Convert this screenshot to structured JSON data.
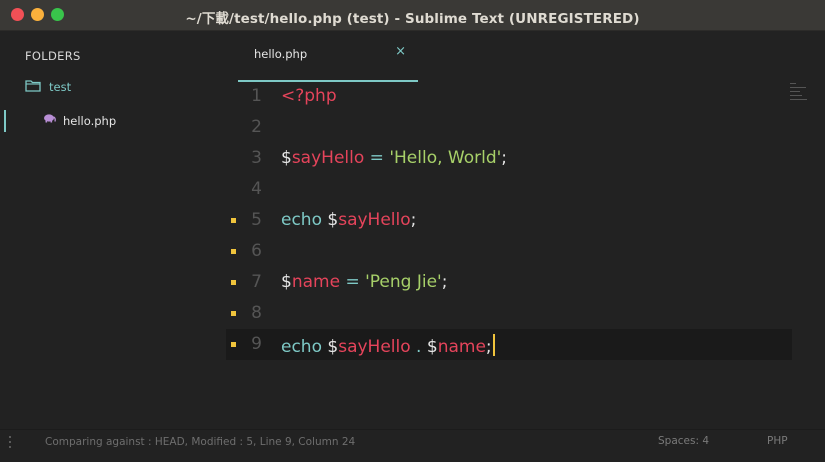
{
  "window": {
    "title": "~/下載/test/hello.php (test) - Sublime Text (UNREGISTERED)"
  },
  "sidebar": {
    "header": "FOLDERS",
    "folder": {
      "name": "test",
      "icon": "folder-icon"
    },
    "file": {
      "name": "hello.php",
      "icon": "php-elephant-icon"
    }
  },
  "tab": {
    "label": "hello.php",
    "close_glyph": "×"
  },
  "editor": {
    "current_line": 9,
    "lines": [
      {
        "num": "1",
        "modified": false,
        "tokens": [
          {
            "t": "<?php",
            "c": "tag"
          }
        ]
      },
      {
        "num": "2",
        "modified": false,
        "tokens": []
      },
      {
        "num": "3",
        "modified": false,
        "tokens": [
          {
            "t": "$",
            "c": "dollar"
          },
          {
            "t": "sayHello",
            "c": "var"
          },
          {
            "t": " = ",
            "c": "op"
          },
          {
            "t": "'Hello, World'",
            "c": "str"
          },
          {
            "t": ";",
            "c": "plain"
          }
        ]
      },
      {
        "num": "4",
        "modified": false,
        "tokens": []
      },
      {
        "num": "5",
        "modified": true,
        "tokens": [
          {
            "t": "echo ",
            "c": "kw"
          },
          {
            "t": "$",
            "c": "dollar"
          },
          {
            "t": "sayHello",
            "c": "var"
          },
          {
            "t": ";",
            "c": "plain"
          }
        ]
      },
      {
        "num": "6",
        "modified": true,
        "tokens": []
      },
      {
        "num": "7",
        "modified": true,
        "tokens": [
          {
            "t": "$",
            "c": "dollar"
          },
          {
            "t": "name",
            "c": "var"
          },
          {
            "t": " = ",
            "c": "op"
          },
          {
            "t": "'Peng Jie'",
            "c": "str"
          },
          {
            "t": ";",
            "c": "plain"
          }
        ]
      },
      {
        "num": "8",
        "modified": true,
        "tokens": []
      },
      {
        "num": "9",
        "modified": true,
        "tokens": [
          {
            "t": "echo ",
            "c": "kw"
          },
          {
            "t": "$",
            "c": "dollar"
          },
          {
            "t": "sayHello",
            "c": "var"
          },
          {
            "t": " . ",
            "c": "op"
          },
          {
            "t": "$",
            "c": "dollar"
          },
          {
            "t": "name",
            "c": "var"
          },
          {
            "t": ";",
            "c": "plain"
          }
        ]
      }
    ]
  },
  "status": {
    "info": "Comparing against : HEAD, Modified : 5, Line 9, Column 24",
    "spaces": "Spaces: 4",
    "syntax": "PHP"
  },
  "colors": {
    "accent": "#7ec9c6",
    "variable": "#e5445b",
    "string": "#a7d069",
    "modified_marker": "#f0c43c"
  }
}
